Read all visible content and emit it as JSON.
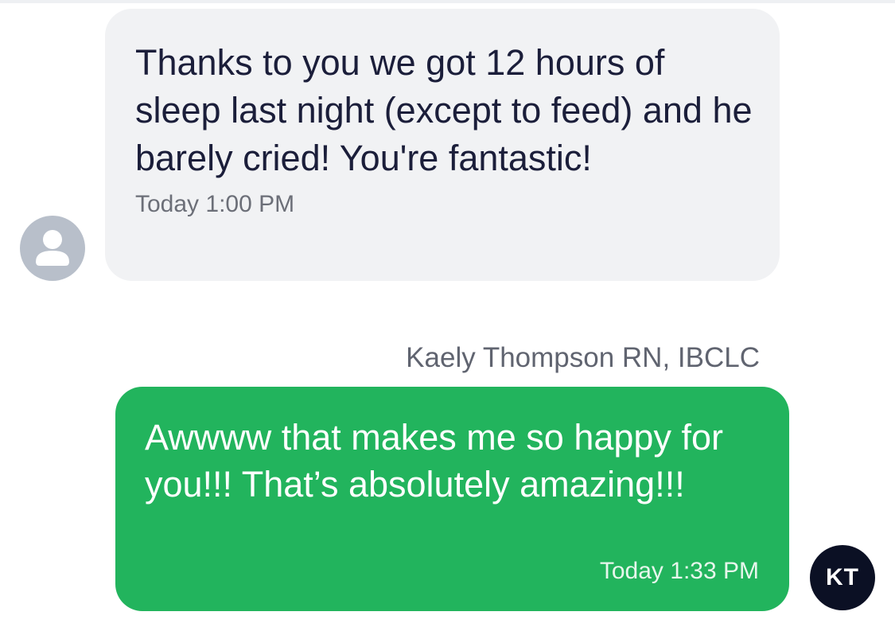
{
  "conversation": {
    "incoming": {
      "avatar_icon": "person-silhouette-icon",
      "text": "Thanks to you we got 12 hours of sleep last night (except to feed) and he barely cried! You're fantastic!",
      "timestamp": "Today 1:00 PM"
    },
    "outgoing": {
      "sender_name": "Kaely Thompson RN, IBCLC",
      "text": "Awwww that makes me so happy for you!!! That’s absolutely amazing!!!",
      "timestamp": "Today 1:33 PM",
      "avatar_initials": "KT"
    }
  },
  "colors": {
    "incoming_bubble": "#f1f2f4",
    "outgoing_bubble": "#22b45d",
    "avatar_dark": "#0b1024",
    "avatar_grey": "#b8bfca"
  }
}
